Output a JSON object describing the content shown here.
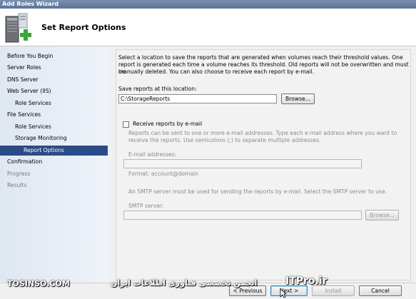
{
  "window": {
    "title": "Add Roles Wizard"
  },
  "header": {
    "title": "Set Report Options",
    "icon": "server-roles-add-icon"
  },
  "nav": {
    "items": [
      {
        "label": "Before You Begin",
        "level": 0,
        "state": "normal"
      },
      {
        "label": "Server Roles",
        "level": 0,
        "state": "normal"
      },
      {
        "label": "DNS Server",
        "level": 0,
        "state": "normal"
      },
      {
        "label": "Web Server (IIS)",
        "level": 0,
        "state": "normal"
      },
      {
        "label": "Role Services",
        "level": 1,
        "state": "normal"
      },
      {
        "label": "File Services",
        "level": 0,
        "state": "normal"
      },
      {
        "label": "Role Services",
        "level": 1,
        "state": "normal"
      },
      {
        "label": "Storage Monitoring",
        "level": 1,
        "state": "normal"
      },
      {
        "label": "Report Options",
        "level": 2,
        "state": "selected"
      },
      {
        "label": "Confirmation",
        "level": 0,
        "state": "normal"
      },
      {
        "label": "Progress",
        "level": 0,
        "state": "disabled"
      },
      {
        "label": "Results",
        "level": 0,
        "state": "disabled"
      }
    ]
  },
  "main": {
    "intro_line1": "Select a location to save the reports that are generated when volumes reach their threshold values. One",
    "intro_line2": "report is generated each time a volume reaches its threshold. Old reports will not be overwritten and must be",
    "intro_line3": "manually deleted. You can also choose to receive each report by e-mail.",
    "save_label": "Save reports at this location:",
    "save_value": "C:\\StorageReports",
    "browse_label": "Browse...",
    "email_checkbox_label": "Receive reports by e-mail",
    "email_checked": false,
    "email_desc_line1": "Reports can be sent to one or more e-mail addresses. Type each e-mail address where you want to",
    "email_desc_line2": "receive the reports. Use semicolons (;) to separate multiple addresses.",
    "email_addresses_label": "E-mail addresses:",
    "email_addresses_value": "",
    "email_format": "Format: account@domain",
    "smtp_desc": "An SMTP server must be used for sending the reports by e-mail. Select the SMTP server to use.",
    "smtp_label": "SMTP server:",
    "smtp_value": "",
    "smtp_browse_label": "Browse..."
  },
  "footer": {
    "previous_label": "< Previous",
    "next_label": "Next >",
    "install_label": "Install",
    "cancel_label": "Cancel"
  },
  "watermark": {
    "left": "TOSINSO.COM",
    "right": "انجمن تخصصی فناوری اطلاعات ایران",
    "brand": "ITPro.ir"
  }
}
